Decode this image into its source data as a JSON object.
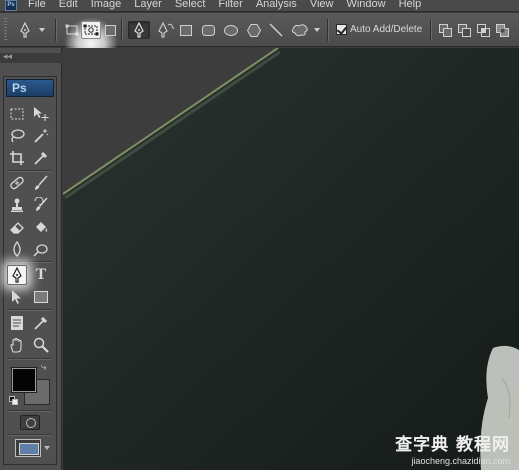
{
  "app": {
    "logo_text": "Ps",
    "mini_logo": "Ps"
  },
  "menu": [
    "File",
    "Edit",
    "Image",
    "Layer",
    "Select",
    "Filter",
    "Analysis",
    "View",
    "Window",
    "Help"
  ],
  "options_bar": {
    "tool_preset_icon": "pen-tool-icon",
    "path_modes": [
      "shape-layers-icon",
      "paths-icon",
      "fill-pixels-icon"
    ],
    "highlighted_mode": "paths-icon",
    "drawing_tools": [
      "pen-icon",
      "freeform-pen-icon",
      "rectangle-icon",
      "rounded-rectangle-icon",
      "ellipse-icon",
      "polygon-icon",
      "line-icon",
      "custom-shape-icon"
    ],
    "auto_add_delete": {
      "label": "Auto Add/Delete",
      "checked": true
    },
    "path_operations": [
      "add-to-path-icon",
      "subtract-from-path-icon",
      "intersect-path-icon",
      "exclude-path-icon"
    ]
  },
  "tools_panel": {
    "tools": [
      "rectangular-marquee-icon",
      "move-icon",
      "lasso-icon",
      "magic-wand-icon",
      "crop-icon",
      "eyedropper-icon",
      "healing-brush-icon",
      "brush-icon",
      "clone-stamp-icon",
      "history-brush-icon",
      "eraser-icon",
      "paint-bucket-icon",
      "blur-icon",
      "dodge-icon",
      "pen-icon",
      "type-icon",
      "path-selection-icon",
      "shape-icon",
      "notes-icon",
      "eyedropper-alt-icon",
      "hand-icon",
      "zoom-icon"
    ],
    "active_tool": "pen-icon",
    "type_tool_label": "T",
    "foreground_color": "#050505",
    "background_color": "#6b6b6b"
  },
  "canvas": {
    "sky_color": "#3b3c3b",
    "wall_color": "#1c2420",
    "edge_color": "#8a9a6a"
  },
  "watermark": {
    "main": "查字典 教程网",
    "sub": "jiaocheng.chazidian.com"
  },
  "colors": {
    "panel": "#505050",
    "menubar": "#4a4a4a",
    "accent": "#2a5a8e"
  }
}
